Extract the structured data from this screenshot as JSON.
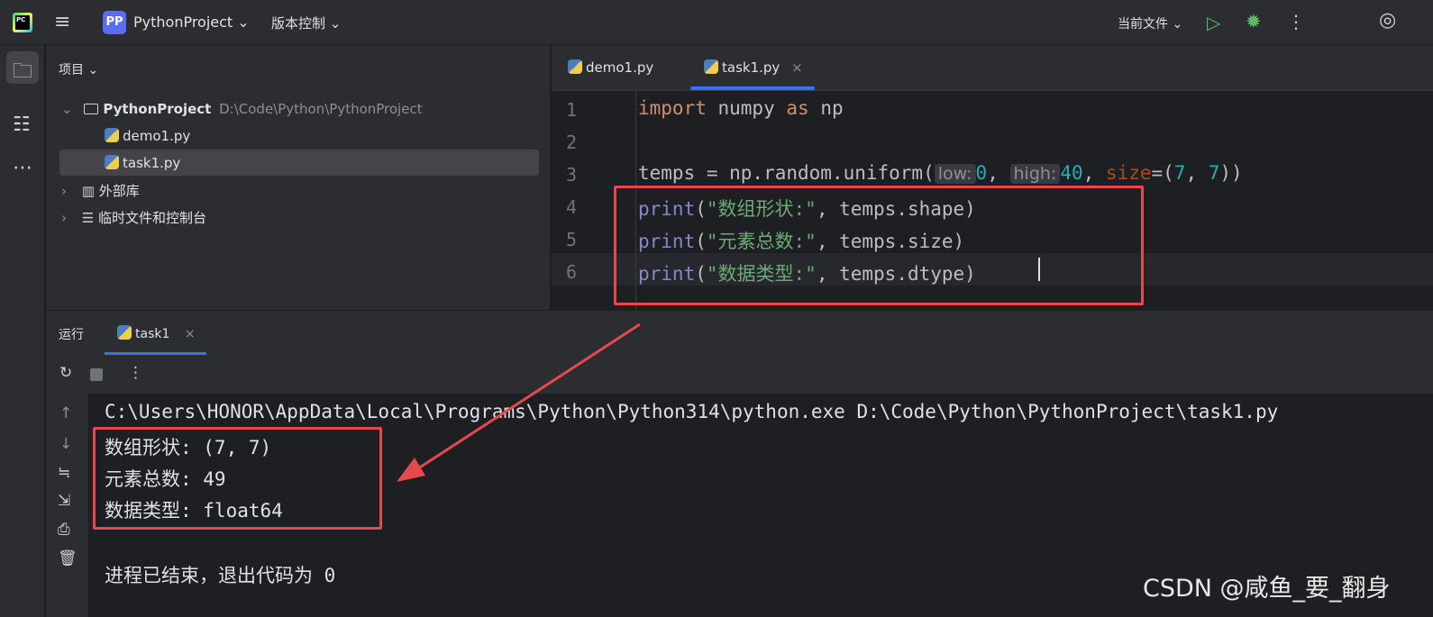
{
  "topbar": {
    "logo_text": "PC",
    "project_badge": "PP",
    "project_name": "PythonProject",
    "vcs_label": "版本控制",
    "current_file_label": "当前文件"
  },
  "project_panel": {
    "title": "项目",
    "root_name": "PythonProject",
    "root_path": "D:\\Code\\Python\\PythonProject",
    "files": [
      "demo1.py",
      "task1.py"
    ],
    "external_libs": "外部库",
    "scratches": "临时文件和控制台"
  },
  "editor": {
    "tabs": [
      "demo1.py",
      "task1.py"
    ],
    "active_tab": "task1.py",
    "line_numbers": [
      "1",
      "2",
      "3",
      "4",
      "5",
      "6"
    ],
    "lines": {
      "l1_import": "import",
      "l1_mod": " numpy ",
      "l1_as": "as",
      "l1_alias": " np",
      "l3_a": "temps = np.random.uniform(",
      "l3_hint_low": "low:",
      "l3_v0": "0",
      "l3_comma1": ", ",
      "l3_hint_high": "high:",
      "l3_v40": "40",
      "l3_comma2": ", ",
      "l3_size": "size",
      "l3_eq": "=(",
      "l3_v7a": "7",
      "l3_comma3": ", ",
      "l3_v7b": "7",
      "l3_end": "))",
      "l4_print": "print",
      "l4_open": "(",
      "l4_str": "\"数组形状:\"",
      "l4_rest": ", temps.shape)",
      "l5_print": "print",
      "l5_open": "(",
      "l5_str": "\"元素总数:\"",
      "l5_rest": ", temps.size)",
      "l6_print": "print",
      "l6_open": "(",
      "l6_str": "\"数据类型:\"",
      "l6_rest": ", temps.dtype)"
    }
  },
  "run_panel": {
    "title": "运行",
    "tab": "task1",
    "console": [
      "C:\\Users\\HONOR\\AppData\\Local\\Programs\\Python\\Python314\\python.exe D:\\Code\\Python\\PythonProject\\task1.py",
      "数组形状: (7, 7)",
      "元素总数: 49",
      "数据类型: float64",
      "进程已结束，退出代码为 0"
    ]
  },
  "watermark": "CSDN @咸鱼_要_翻身",
  "colors": {
    "accent": "#3574f0",
    "annotation": "#e5484d",
    "run_green": "#5fb865"
  }
}
